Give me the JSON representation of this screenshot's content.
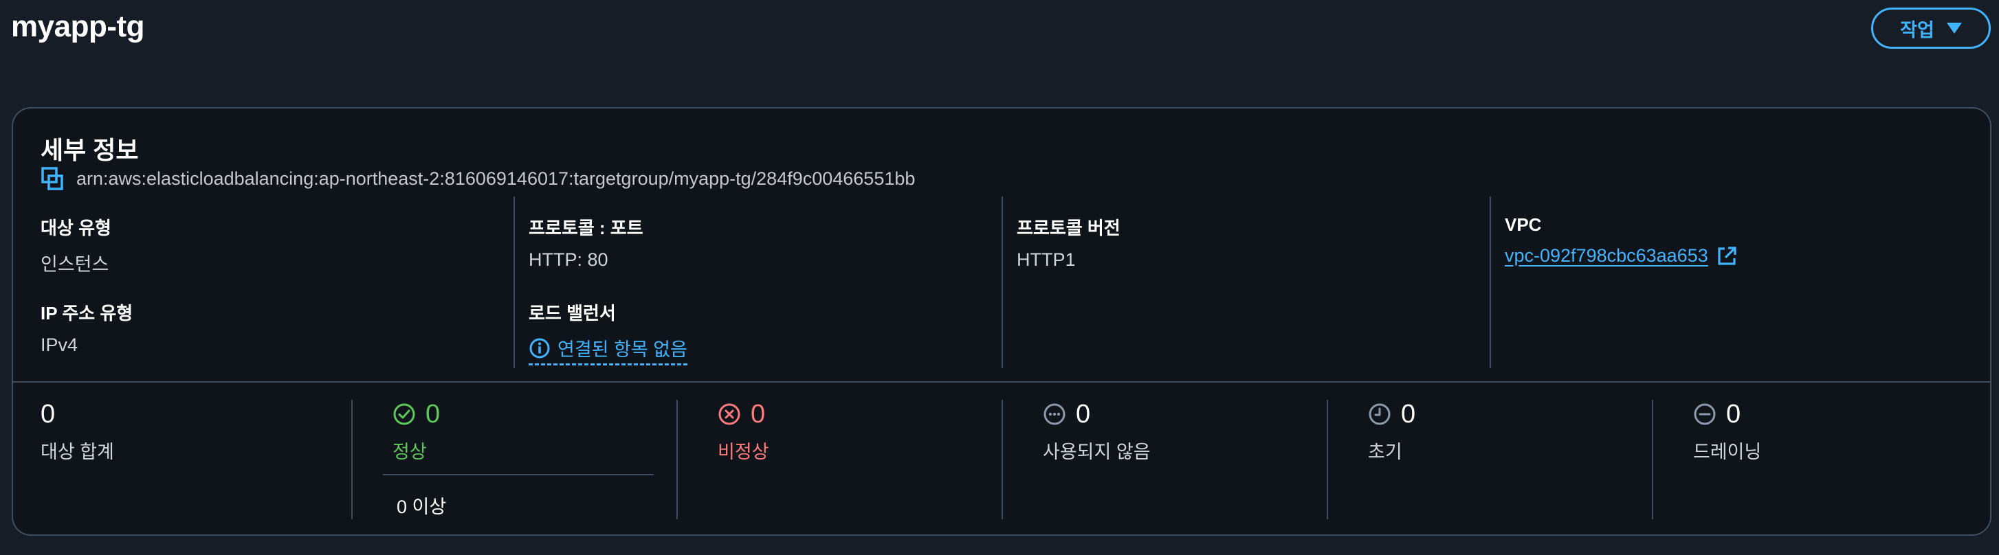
{
  "page": {
    "title": "myapp-tg",
    "actions_label": "작업"
  },
  "details": {
    "heading": "세부 정보",
    "arn": "arn:aws:elasticloadbalancing:ap-northeast-2:816069146017:targetgroup/myapp-tg/284f9c00466551bb",
    "target_type": {
      "label": "대상 유형",
      "value": "인스턴스"
    },
    "ip_address_type": {
      "label": "IP 주소 유형",
      "value": "IPv4"
    },
    "protocol_port": {
      "label": "프로토콜 : 포트",
      "value": "HTTP: 80"
    },
    "load_balancer": {
      "label": "로드 밸런서",
      "value": "연결된 항목 없음"
    },
    "protocol_version": {
      "label": "프로토콜 버전",
      "value": "HTTP1"
    },
    "vpc": {
      "label": "VPC",
      "value": "vpc-092f798cbc63aa653"
    }
  },
  "stats": {
    "total": {
      "count": "0",
      "label": "대상 합계"
    },
    "healthy": {
      "count": "0",
      "label": "정상",
      "sub": "0 이상"
    },
    "unhealthy": {
      "count": "0",
      "label": "비정상"
    },
    "unused": {
      "count": "0",
      "label": "사용되지 않음"
    },
    "initial": {
      "count": "0",
      "label": "초기"
    },
    "draining": {
      "count": "0",
      "label": "드레이닝"
    }
  },
  "colors": {
    "background": "#161d26",
    "card_background": "#0f141a",
    "accent": "#42b4ff",
    "healthy": "#5cc85a",
    "unhealthy": "#ff7a7a",
    "neutral_icon": "#8d99a8",
    "border": "#414d5c"
  },
  "icons": {
    "actions_caret": "caret-down-icon",
    "copy": "copy-icon",
    "external_link": "external-link-icon",
    "info": "info-icon",
    "healthy": "check-circle-icon",
    "unhealthy": "x-circle-icon",
    "unused": "ellipsis-circle-icon",
    "initial": "clock-icon",
    "draining": "minus-circle-icon"
  }
}
